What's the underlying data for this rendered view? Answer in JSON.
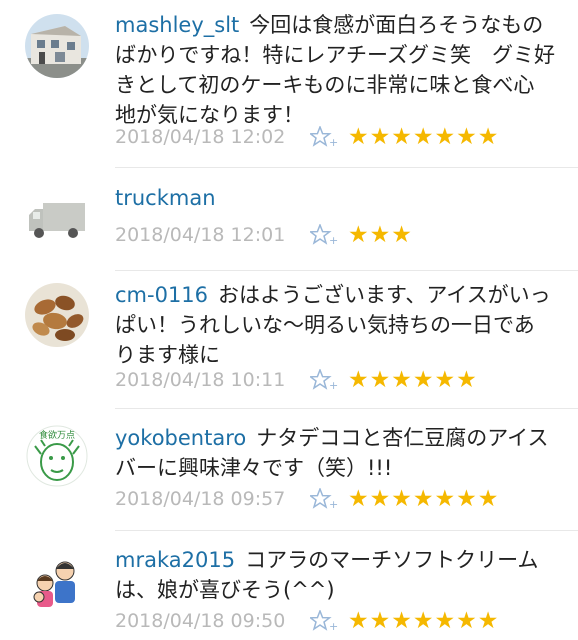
{
  "comments": [
    {
      "username": "mashley_slt",
      "text": "今回は食感が面白ろそうなものばかりですね！特にレアチーズグミ笑　グミ好きとして初のケーキものに非常に味と食べ心地が気になります！",
      "timestamp": "2018/04/18 12:02",
      "stars": "★★★★★★★",
      "star_count": 7,
      "avatar_icon": "house-photo"
    },
    {
      "username": "truckman",
      "text": "",
      "timestamp": "2018/04/18 12:01",
      "stars": "★★★",
      "star_count": 3,
      "avatar_icon": "truck-illustration"
    },
    {
      "username": "cm-0116",
      "text": "おはようございます、アイスがいっぱい！うれしいな〜明るい気持ちの一日であります様に",
      "timestamp": "2018/04/18 10:11",
      "stars": "★★★★★★",
      "star_count": 6,
      "avatar_icon": "nuts-photo"
    },
    {
      "username": "yokobentaro",
      "text": "ナタデココと杏仁豆腐のアイスバーに興味津々です（笑）!!!",
      "timestamp": "2018/04/18 09:57",
      "stars": "★★★★★★★",
      "star_count": 7,
      "avatar_icon": "face-drawing",
      "avatar_text": "食欲万点"
    },
    {
      "username": "mraka2015",
      "text": "コアラのマーチソフトクリームは、娘が喜びそう(^^)",
      "timestamp": "2018/04/18 09:50",
      "stars": "★★★★★★★",
      "star_count": 7,
      "avatar_icon": "family-illustration"
    }
  ],
  "colors": {
    "username": "#1d6fa5",
    "text": "#222222",
    "timestamp": "#b9b9b9",
    "star": "#f5b800",
    "add_star_icon": "#9ab7d8"
  }
}
